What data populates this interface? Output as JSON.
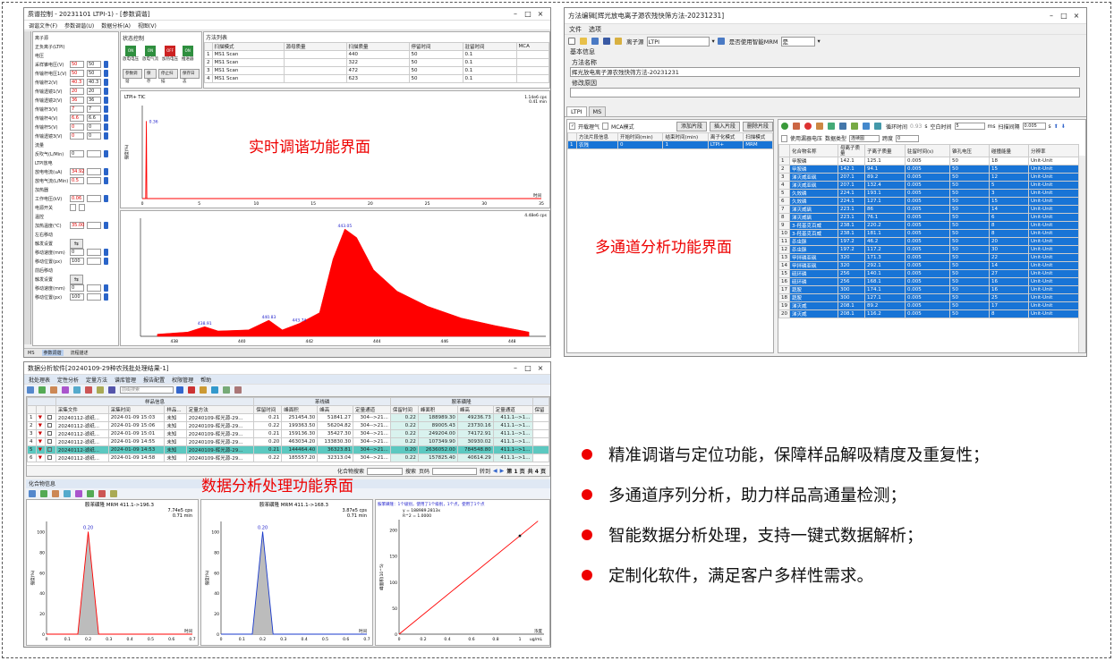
{
  "colors": {
    "accent": "#e00000",
    "select_blue": "#1874d6",
    "plot_red": "#ff0000",
    "plot_blue": "#1a3acc"
  },
  "tuning": {
    "title": "质谱控制 - 20231101 LTPI-1) - [参数调谐]",
    "menu": [
      "调谐文件(F)",
      "参数调谐(U)",
      "数据分析(A)",
      "视图(V)"
    ],
    "left_labels": [
      "离子源",
      "正负离子(LTPI)",
      "电压",
      "采样锥电压(V)",
      "传输杆电压1(V)",
      "传输杆2(V)",
      "传输透镜1(V)",
      "传输透镜2(V)",
      "传输杆3(V)",
      "传输杆4(V)",
      "传输杆5(V)",
      "传输透镜3(V)",
      "流量",
      "反吹气(L/Min)",
      "LTPI放电",
      "放电电流(uA)",
      "放电气流(L/Min)",
      "加热器",
      "工作电压(kV)",
      "电源开关",
      "温控",
      "加热温度(℃)",
      "左右移动",
      "触发设置",
      "移动速度(mm)",
      "移动位置(px)",
      "前后移动",
      "触发设置",
      "移动速度(mm)",
      "移动位置(px)"
    ],
    "left_values": [
      "50",
      "50",
      "40.3",
      "20",
      "36",
      "7",
      "6.6",
      "0",
      "0",
      "34.92",
      "0.5",
      "0.06",
      "35.00",
      "0",
      "100",
      "0",
      "100"
    ],
    "control_title": "状态控制",
    "controls": [
      {
        "state": "ON",
        "label": "放电电压"
      },
      {
        "state": "ON",
        "label": "放电气流"
      },
      {
        "state": "OFF",
        "label": "加热电压"
      },
      {
        "state": "ON",
        "label": "推进器"
      }
    ],
    "ctrl_buttons": [
      "参数调谐",
      "保存",
      "停止扫描",
      "保存日志"
    ],
    "method_title": "方法列表",
    "method_headers": [
      "",
      "扫描模式",
      "源母质量",
      "扫描质量",
      "停留时间",
      "驻留时间",
      "MCA"
    ],
    "method_rows": [
      [
        "1",
        "MS1 Scan",
        "",
        "440",
        "50",
        "0.1"
      ],
      [
        "2",
        "MS1 Scan",
        "",
        "322",
        "50",
        "0.1"
      ],
      [
        "3",
        "MS1 Scan",
        "",
        "472",
        "50",
        "0.1"
      ],
      [
        "4",
        "MS1 Scan",
        "",
        "623",
        "50",
        "0.1"
      ]
    ],
    "tic_label": "LTPI+ TIC",
    "tic_info": [
      "1.14e6 cps",
      "0.41 min"
    ],
    "tic_peak": "0.36",
    "spec_peaks": [
      "438.91",
      "440.83",
      "443.05",
      "443.74"
    ],
    "spec_info": "4.48e6 cps",
    "status": [
      "MS",
      "参数调谐",
      "流程描述"
    ],
    "overlay": "实时调谐功能界面",
    "chart_data": [
      {
        "type": "line",
        "title": "LTPI+ TIC",
        "x": [
          0,
          0.3,
          0.36,
          0.4,
          35
        ],
        "y": [
          0,
          0,
          1.0,
          0,
          0
        ],
        "xlim": [
          0,
          35
        ],
        "ylim": [
          0,
          1.2
        ],
        "xlabel": "时间",
        "ylabel": "强度(%)"
      },
      {
        "type": "area",
        "x": [
          437.5,
          438.4,
          438.9,
          439.3,
          440.2,
          440.8,
          441.2,
          441.7,
          442.3,
          442.7,
          443.05,
          443.4,
          443.9,
          444.6,
          445.5,
          446.5,
          447.5,
          448.5
        ],
        "y": [
          2,
          4,
          9,
          5,
          6,
          15,
          6,
          12,
          22,
          72,
          100,
          92,
          62,
          42,
          28,
          17,
          10,
          4
        ],
        "xlim": [
          437,
          449
        ],
        "ylim": [
          0,
          110
        ]
      }
    ]
  },
  "method": {
    "title": "方法编辑[辉光放电离子源农残快筛方法-20231231]",
    "menu": [
      "文件",
      "选项"
    ],
    "source_label": "离子源",
    "source_value": "LTPI",
    "mrm_label": "是否使用智能MRM",
    "mrm_value": "是",
    "basic_info": "基本信息",
    "name_label": "方法名称",
    "name_value": "辉光放电离子源农残快筛方法-20231231",
    "reason_label": "修改原因",
    "tabs": [
      "LTPI",
      "MS"
    ],
    "seg_opts": [
      "开载理气",
      "MCA模式"
    ],
    "seg_buttons": [
      "添加片段",
      "插入片段",
      "删除片段"
    ],
    "seg_headers": [
      "",
      "方法片段信息",
      "开始时间(min)",
      "结束时间(min)",
      "离子化模式",
      "扫描模式"
    ],
    "seg_row": [
      "1",
      "农残",
      "0",
      "1",
      "LTPI+",
      "MRM"
    ],
    "tool_texts": [
      "循环时间",
      "0.93",
      "s",
      "空白时间",
      "5",
      "ms",
      "扫描间隔",
      "0.005",
      "s"
    ],
    "fields": [
      "使用漏器电压",
      "数据类型",
      "连续图",
      "跨度",
      "0"
    ],
    "headers": [
      "",
      "化合物名称",
      "母离子质量",
      "子离子质量",
      "驻留时间(s)",
      "锥孔电压",
      "碰撞能量",
      "分辨率"
    ],
    "rows": [
      [
        "1",
        "甲胺磷",
        "142.1",
        "125.1",
        "0.005",
        "50",
        "18",
        "Unit-Unit"
      ],
      [
        "2",
        "甲胺磷",
        "142.1",
        "94.1",
        "0.005",
        "50",
        "15",
        "Unit-Unit"
      ],
      [
        "3",
        "涕灭威亚砜",
        "207.1",
        "89.2",
        "0.005",
        "50",
        "12",
        "Unit-Unit"
      ],
      [
        "4",
        "涕灭威亚砜",
        "207.1",
        "132.4",
        "0.005",
        "50",
        "5",
        "Unit-Unit"
      ],
      [
        "5",
        "久效磷",
        "224.1",
        "193.1",
        "0.005",
        "50",
        "3",
        "Unit-Unit"
      ],
      [
        "6",
        "久效磷",
        "224.1",
        "127.1",
        "0.005",
        "50",
        "15",
        "Unit-Unit"
      ],
      [
        "7",
        "涕灭威砜",
        "223.1",
        "86",
        "0.005",
        "50",
        "14",
        "Unit-Unit"
      ],
      [
        "8",
        "涕灭威砜",
        "223.1",
        "76.1",
        "0.005",
        "50",
        "6",
        "Unit-Unit"
      ],
      [
        "9",
        "3-羟基克百威",
        "238.1",
        "220.2",
        "0.005",
        "50",
        "8",
        "Unit-Unit"
      ],
      [
        "10",
        "3-羟基克百威",
        "238.1",
        "181.1",
        "0.005",
        "50",
        "8",
        "Unit-Unit"
      ],
      [
        "11",
        "杀虫脒",
        "197.2",
        "46.2",
        "0.005",
        "50",
        "20",
        "Unit-Unit"
      ],
      [
        "12",
        "杀虫脒",
        "197.2",
        "117.2",
        "0.005",
        "50",
        "30",
        "Unit-Unit"
      ],
      [
        "13",
        "甲拌磷亚砜",
        "320",
        "171.3",
        "0.005",
        "50",
        "22",
        "Unit-Unit"
      ],
      [
        "14",
        "甲拌磷亚砜",
        "320",
        "292.1",
        "0.005",
        "50",
        "14",
        "Unit-Unit"
      ],
      [
        "15",
        "硫环磷",
        "256",
        "140.1",
        "0.005",
        "50",
        "27",
        "Unit-Unit"
      ],
      [
        "16",
        "硫环磷",
        "256",
        "168.1",
        "0.005",
        "50",
        "16",
        "Unit-Unit"
      ],
      [
        "17",
        "蔬胺",
        "300",
        "174.1",
        "0.005",
        "50",
        "16",
        "Unit-Unit"
      ],
      [
        "18",
        "蔬胺",
        "300",
        "127.1",
        "0.005",
        "50",
        "25",
        "Unit-Unit"
      ],
      [
        "19",
        "涕灭威",
        "208.1",
        "89.2",
        "0.005",
        "50",
        "17",
        "Unit-Unit"
      ],
      [
        "20",
        "涕灭威",
        "208.1",
        "116.2",
        "0.005",
        "50",
        "8",
        "Unit-Unit"
      ]
    ],
    "overlay": "多通道分析功能界面"
  },
  "analysis": {
    "title": "数据分析软件[20240109-29种农残批处理结果-1]",
    "menu": [
      "批处理表",
      "定性分析",
      "定量方法",
      "谱库管理",
      "报告配置",
      "权限管理",
      "帮助"
    ],
    "search_ph": "前缀搜索",
    "group_sample": "样品信息",
    "group_comp": "苯线磷",
    "group_ref": "胺苯磺隆",
    "headers": [
      "",
      "",
      "",
      "采集文件",
      "采集时间",
      "样品...",
      "定量方法",
      "保留时间",
      "峰面积",
      "峰高",
      "定量通道",
      "保留时间",
      "峰面积",
      "峰高",
      "定量通道",
      "保留"
    ],
    "rows": [
      [
        "1",
        "20240112-滤纸...",
        "2024-01-09 15:03",
        "未知",
        "20240109-辉光源-29...",
        "0.21",
        "251454.30",
        "51841.27",
        "304-->21...",
        "0.22",
        "188989.30",
        "49236.73",
        "411.1-->1..."
      ],
      [
        "2",
        "20240112-滤纸...",
        "2024-01-09 15:06",
        "未知",
        "20240109-辉光源-29...",
        "0.22",
        "199363.50",
        "56204.82",
        "304-->21...",
        "0.22",
        "89005.43",
        "23730.16",
        "411.1-->1..."
      ],
      [
        "3",
        "20240112-滤纸...",
        "2024-01-09 15:01",
        "未知",
        "20240109-辉光源-29...",
        "0.21",
        "159136.30",
        "35427.30",
        "304-->21...",
        "0.22",
        "249204.00",
        "74172.91",
        "411.1-->1..."
      ],
      [
        "4",
        "20240112-滤纸...",
        "2024-01-09 14:55",
        "未知",
        "20240109-辉光源-29...",
        "0.20",
        "463034.20",
        "133830.30",
        "304-->21...",
        "0.22",
        "107349.90",
        "30930.02",
        "411.1-->1..."
      ],
      [
        "5",
        "20240112-滤纸...",
        "2024-01-09 14:53",
        "未知",
        "20240109-辉光源-29...",
        "0.21",
        "144464.40",
        "36323.81",
        "304-->21...",
        "0.20",
        "2636052.00",
        "784548.80",
        "411.1-->1..."
      ],
      [
        "6",
        "20240112-滤纸...",
        "2024-01-09 14:58",
        "未知",
        "20240109-辉光源-29...",
        "0.22",
        "185557.20",
        "32313.04",
        "304-->21...",
        "0.22",
        "157825.40",
        "40614.29",
        "411.1-->1..."
      ]
    ],
    "pager": [
      "化合物搜索",
      "搜索",
      "页码",
      "转到",
      "第 1 页",
      "共 4 页"
    ],
    "info_title": "化合物信息",
    "plot1_title": "胺苯磺隆 MRM 411.1->196.3",
    "plot1_info": [
      "7.74e5 cps",
      "0.71 min"
    ],
    "plot2_title": "胺苯磺隆 MRM 411.1->168.3",
    "plot2_info": [
      "3.87e5 cps",
      "0.71 min"
    ],
    "peak_label": "0.20",
    "plot3_title": "胺苯磺隆：1个级别，使用了1个级别，1个点，使用了1个点",
    "plot3_eq": "y = 188989.2813x",
    "plot3_r": "R^2 = 1.0000",
    "axis_time": "时间",
    "axis_conc": "浓度",
    "conc_unit": "ug/mL",
    "ylabel_pct": "强度(%)",
    "ylabel_area": "峰面积(10^5)",
    "overlay": "数据分析处理功能界面",
    "chart_data": [
      {
        "type": "area",
        "title": "胺苯磺隆 MRM 411.1->196.3",
        "x": [
          0,
          0.1,
          0.15,
          0.2,
          0.25,
          0.3,
          0.7
        ],
        "y": [
          0,
          0,
          0,
          100,
          0,
          0,
          0
        ],
        "xlim": [
          0,
          0.7
        ],
        "ylim": [
          0,
          110
        ]
      },
      {
        "type": "area",
        "title": "胺苯磺隆 MRM 411.1->168.3",
        "x": [
          0,
          0.1,
          0.15,
          0.2,
          0.25,
          0.3,
          0.7
        ],
        "y": [
          0,
          0,
          0,
          100,
          0,
          0,
          0
        ],
        "xlim": [
          0,
          0.7
        ],
        "ylim": [
          0,
          110
        ]
      },
      {
        "type": "line",
        "title": "胺苯磺隆：1个级别，使用了1个级别，1个点，使用了1个点",
        "x": [
          0,
          1.0,
          1.2
        ],
        "y": [
          0,
          188.99,
          226.8
        ],
        "points": [
          [
            1.0,
            188.99
          ]
        ],
        "xlim": [
          0,
          1.2
        ],
        "ylim": [
          0,
          220
        ],
        "xlabel": "浓度",
        "ylabel": "峰面积(10^5)"
      }
    ]
  },
  "features": [
    "精准调谐与定位功能，保障样品解吸精度及重复性；",
    "多通道序列分析，助力样品高通量检测；",
    "智能数据分析处理，支持一键式数据解析；",
    "定制化软件，满足客户多样性需求。"
  ]
}
